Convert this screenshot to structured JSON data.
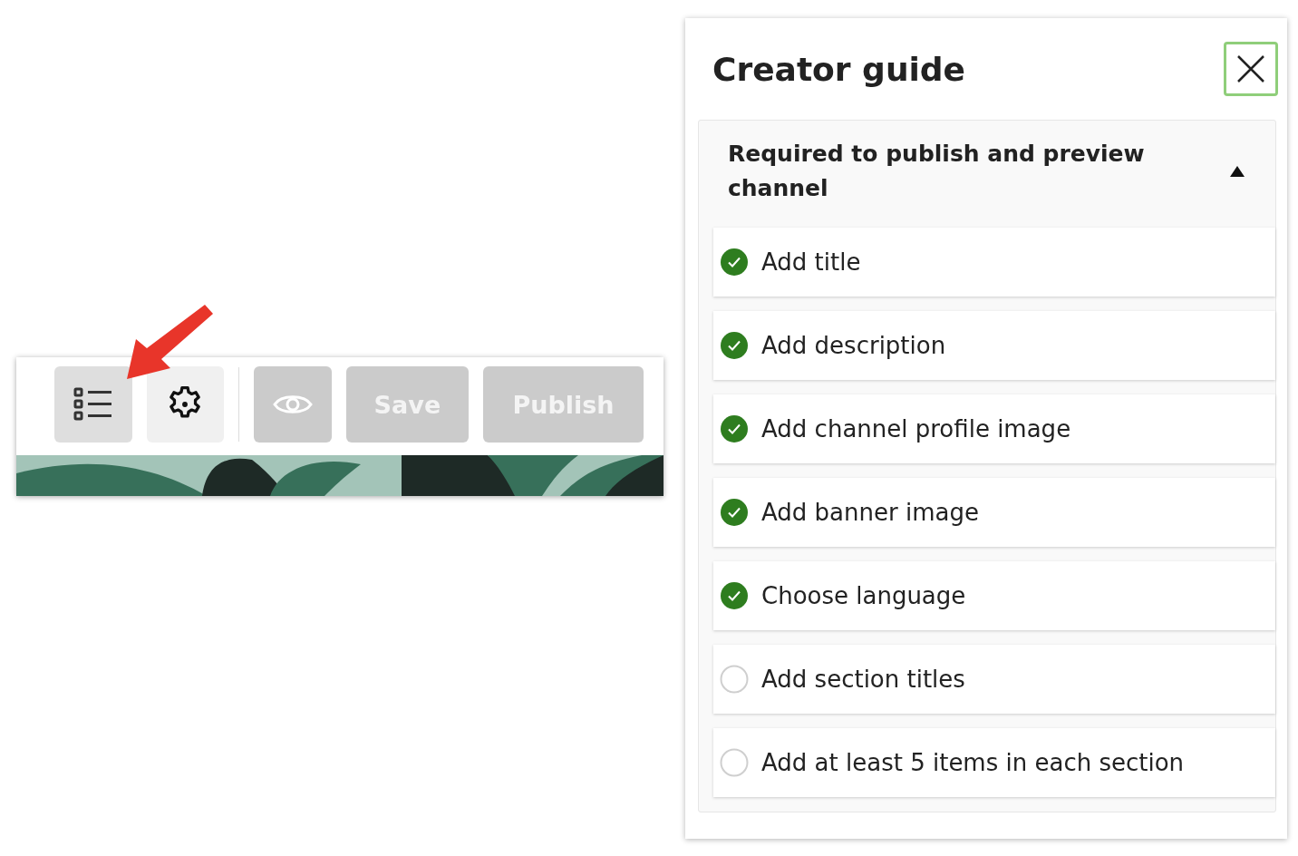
{
  "toolbar": {
    "buttons": [
      {
        "kind": "checklist",
        "selected": true,
        "disabled": false
      },
      {
        "kind": "settings",
        "selected": false,
        "disabled": false
      },
      {
        "kind": "preview",
        "disabled": true
      },
      {
        "kind": "text",
        "label": "Save",
        "disabled": true
      },
      {
        "kind": "text",
        "label": "Publish",
        "disabled": true
      }
    ]
  },
  "guide": {
    "title": "Creator guide",
    "section": {
      "title": "Required to publish and preview channel",
      "expanded": true,
      "items": [
        {
          "label": "Add title",
          "done": true
        },
        {
          "label": "Add description",
          "done": true
        },
        {
          "label": "Add channel profile image",
          "done": true
        },
        {
          "label": "Add banner image",
          "done": true
        },
        {
          "label": "Choose language",
          "done": true
        },
        {
          "label": "Add section titles",
          "done": false
        },
        {
          "label": "Add at least 5 items in each section",
          "done": false
        }
      ]
    }
  }
}
